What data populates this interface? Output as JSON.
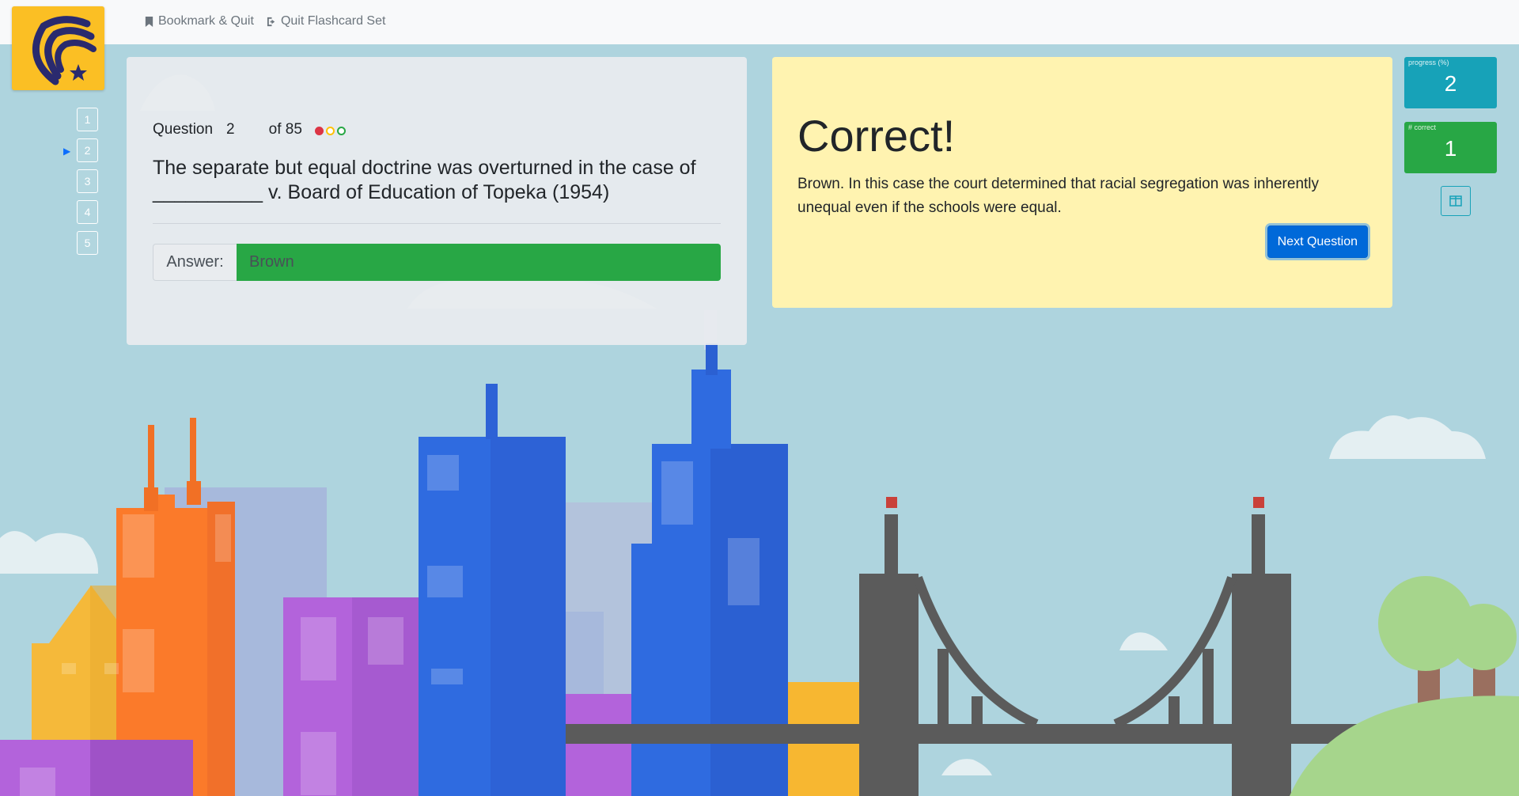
{
  "nav": {
    "bookmark_label": "Bookmark & Quit",
    "quit_label": "Quit Flashcard Set"
  },
  "question_list": [
    "1",
    "2",
    "3",
    "4",
    "5"
  ],
  "question": {
    "label": "Question",
    "number": "2",
    "of_text": "of 85",
    "text": "The separate but equal doctrine was overturned in the case of __________ v. Board of Education of Topeka (1954)",
    "answer_label": "Answer:",
    "answer_value": "Brown"
  },
  "result": {
    "title": "Correct!",
    "explanation": "Brown. In this case the court determined that racial segregation was inherently unequal even if the schools were equal.",
    "next_label": "Next Question"
  },
  "stats": {
    "progress_caption": "progress (%)",
    "progress_value": "2",
    "correct_caption": "# correct",
    "correct_value": "1"
  },
  "colors": {
    "sky": "#aed4de",
    "logo": "#fbbf24",
    "answer_bg": "#28a745",
    "result_bg": "#fff3b0",
    "progress": "#17a2b8",
    "correct": "#28a745",
    "primary": "#0069d9"
  }
}
